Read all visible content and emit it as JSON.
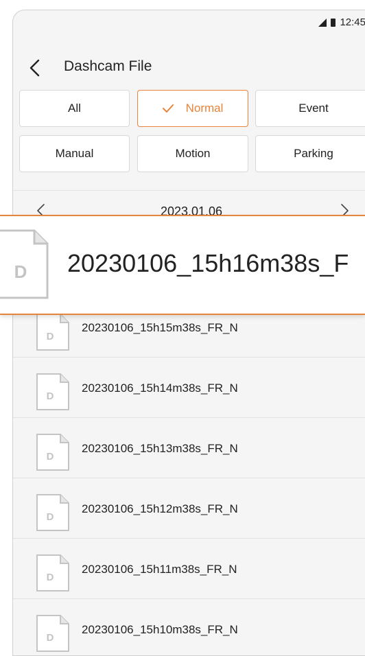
{
  "status": {
    "time": "12:45"
  },
  "header": {
    "title": "Dashcam File"
  },
  "filters": [
    {
      "label": "All",
      "selected": false
    },
    {
      "label": "Normal",
      "selected": true
    },
    {
      "label": "Event",
      "selected": false
    },
    {
      "label": "Manual",
      "selected": false
    },
    {
      "label": "Motion",
      "selected": false
    },
    {
      "label": "Parking",
      "selected": false
    }
  ],
  "date_nav": {
    "date": "2023.01.06"
  },
  "file_type_letter": "D",
  "popup": {
    "file_name": "20230106_15h16m38s_F"
  },
  "files": [
    {
      "name": "20230106_15h15m38s_FR_N"
    },
    {
      "name": "20230106_15h14m38s_FR_N"
    },
    {
      "name": "20230106_15h13m38s_FR_N"
    },
    {
      "name": "20230106_15h12m38s_FR_N"
    },
    {
      "name": "20230106_15h11m38s_FR_N"
    },
    {
      "name": "20230106_15h10m38s_FR_N"
    }
  ],
  "colors": {
    "accent": "#e8833a",
    "icon_gray": "#c4c4c4"
  }
}
